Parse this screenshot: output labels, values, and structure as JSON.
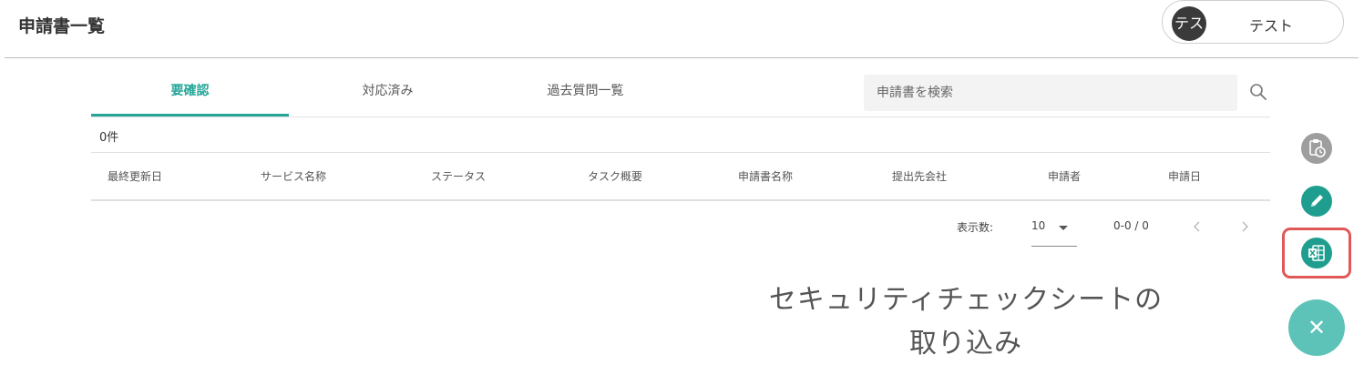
{
  "header": {
    "title": "申請書一覧",
    "user": {
      "avatar_text": "テス",
      "name": "テスト"
    }
  },
  "tabs": [
    {
      "label": "要確認",
      "active": true
    },
    {
      "label": "対応済み",
      "active": false
    },
    {
      "label": "過去質問一覧",
      "active": false
    }
  ],
  "search": {
    "placeholder": "申請書を検索",
    "value": "",
    "icon": "search-icon"
  },
  "results": {
    "count_label": "0件"
  },
  "table": {
    "columns": [
      "最終更新日",
      "サービス名称",
      "ステータス",
      "タスク概要",
      "申請書名称",
      "提出先会社",
      "申請者",
      "申請日"
    ],
    "rows": []
  },
  "pagination": {
    "per_page_label": "表示数:",
    "per_page_value": "10",
    "range_label": "0-0 / 0"
  },
  "fab": {
    "items": [
      {
        "name": "history",
        "icon": "clipboard-clock-icon",
        "color": "#9e9e9e"
      },
      {
        "name": "edit",
        "icon": "pencil-icon",
        "color": "#1f9e8f"
      },
      {
        "name": "import",
        "icon": "spreadsheet-import-icon",
        "color": "#1f9e8f"
      }
    ],
    "close_icon": "close-icon",
    "close_color": "#5dc3b8",
    "highlight_color": "#e05858"
  },
  "tooltip": {
    "line1": "セキュリティチェックシートの",
    "line2": "取り込み"
  },
  "colors": {
    "accent": "#26a69a",
    "divider": "#e0e0e0"
  }
}
